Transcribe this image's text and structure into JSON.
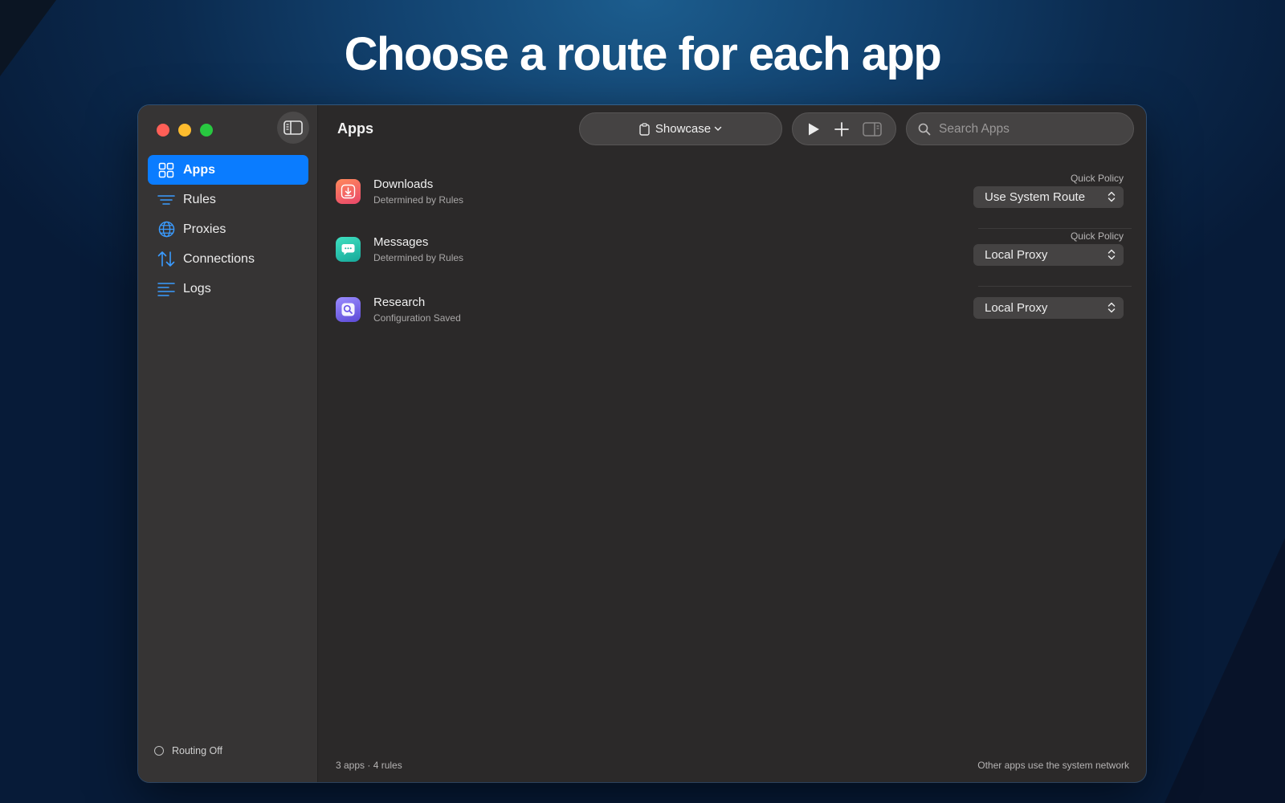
{
  "headline": "Choose a route for each app",
  "window": {
    "title": "Apps",
    "profile_label": "Showcase",
    "search": {
      "placeholder": "Search Apps"
    }
  },
  "sidebar": {
    "items": [
      {
        "label": "Apps",
        "icon": "grid-icon",
        "active": true
      },
      {
        "label": "Rules",
        "icon": "lines-icon",
        "active": false
      },
      {
        "label": "Proxies",
        "icon": "globe-icon",
        "active": false
      },
      {
        "label": "Connections",
        "icon": "arrows-up-down-icon",
        "active": false
      },
      {
        "label": "Logs",
        "icon": "list-icon",
        "active": false
      }
    ],
    "routing_status": "Routing Off"
  },
  "apps": [
    {
      "name": "Downloads",
      "status": "Determined by Rules",
      "policy_label": "Quick Policy",
      "policy": "Use System Route",
      "icon": "download-icon",
      "icon_color": "#f06a5a"
    },
    {
      "name": "Messages",
      "status": "Determined by Rules",
      "policy_label": "Quick Policy",
      "policy": "Local Proxy",
      "icon": "chat-bubble-icon",
      "icon_color": "#2fc6b0"
    },
    {
      "name": "Research",
      "status": "Configuration Saved",
      "policy_label": "",
      "policy": "Local Proxy",
      "icon": "magnifier-icon",
      "icon_color": "#7a5cf0"
    }
  ],
  "footer": {
    "left": "3 apps · 4 rules",
    "right": "Other apps use the system network"
  },
  "colors": {
    "accent": "#0a7cff",
    "window_bg": "#2b2929",
    "sidebar_bg": "#363434"
  }
}
